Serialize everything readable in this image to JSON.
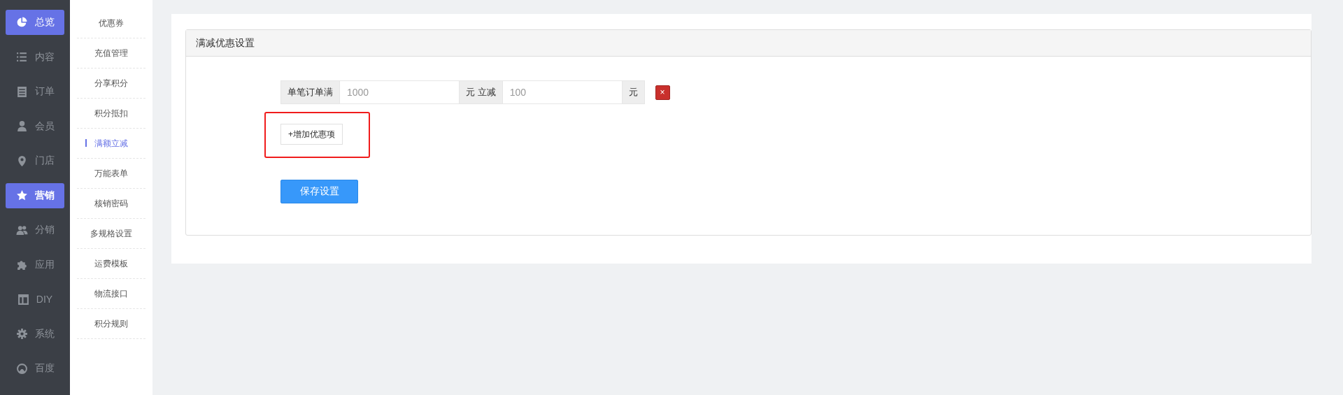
{
  "nav": [
    {
      "label": "总览",
      "selected": false,
      "highlighted": true
    },
    {
      "label": "内容",
      "selected": false,
      "highlighted": false
    },
    {
      "label": "订单",
      "selected": false,
      "highlighted": false
    },
    {
      "label": "会员",
      "selected": false,
      "highlighted": false
    },
    {
      "label": "门店",
      "selected": false,
      "highlighted": false
    },
    {
      "label": "营销",
      "selected": true,
      "highlighted": false
    },
    {
      "label": "分销",
      "selected": false,
      "highlighted": false
    },
    {
      "label": "应用",
      "selected": false,
      "highlighted": false
    },
    {
      "label": "DIY",
      "selected": false,
      "highlighted": false
    },
    {
      "label": "系统",
      "selected": false,
      "highlighted": false
    },
    {
      "label": "百度",
      "selected": false,
      "highlighted": false
    }
  ],
  "submenu": [
    {
      "label": "优惠券",
      "selected": false
    },
    {
      "label": "充值管理",
      "selected": false
    },
    {
      "label": "分享积分",
      "selected": false
    },
    {
      "label": "积分抵扣",
      "selected": false
    },
    {
      "label": "满额立减",
      "selected": true
    },
    {
      "label": "万能表单",
      "selected": false
    },
    {
      "label": "核销密码",
      "selected": false
    },
    {
      "label": "多规格设置",
      "selected": false
    },
    {
      "label": "运费模板",
      "selected": false
    },
    {
      "label": "物流接口",
      "selected": false
    },
    {
      "label": "积分规则",
      "selected": false
    }
  ],
  "panel": {
    "title": "满减优惠设置",
    "rules": [
      {
        "threshold_label": "单笔订单满",
        "threshold": "1000",
        "discount_label": "元 立减",
        "discount": "100",
        "unit": "元",
        "delete": "×"
      }
    ],
    "add_button": {
      "label": "+增加优惠项",
      "highlighted": true
    },
    "save_button": "保存设置"
  }
}
